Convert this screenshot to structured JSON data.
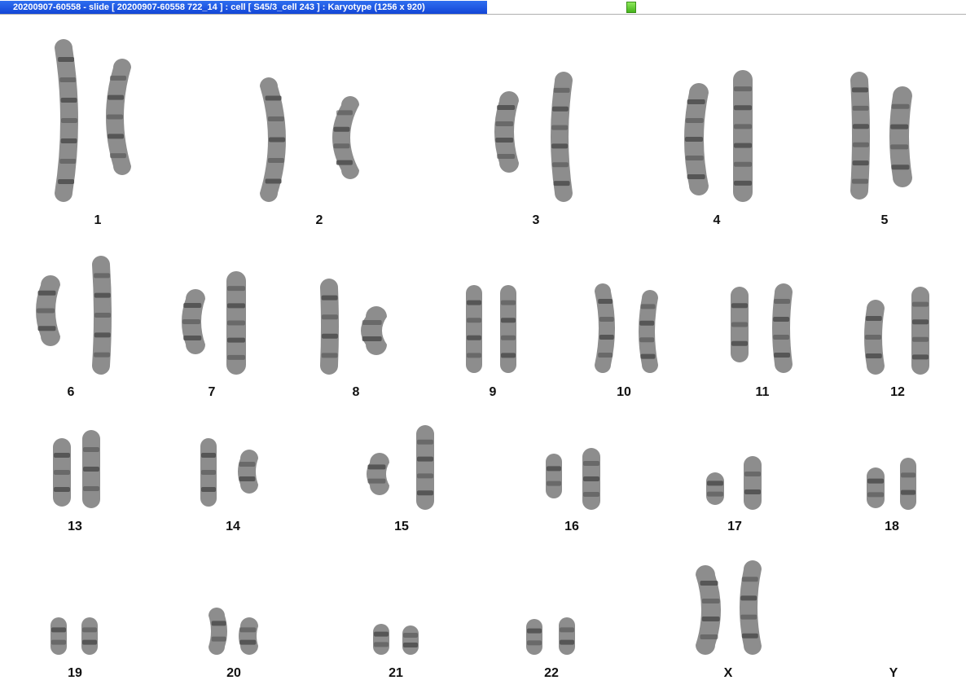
{
  "window": {
    "title": "20200907-60558 - slide [ 20200907-60558 722_14 ] : cell [ S45/3_cell 243 ] : Karyotype  (1256 x 920)"
  },
  "colors": {
    "title_bar": "#1a4fe0",
    "status_indicator": "#6bd43a",
    "chromosome": "#8d8d8d",
    "band": "#4c4c4c"
  },
  "karyotype": {
    "groups": [
      {
        "label": "1",
        "count": 2
      },
      {
        "label": "2",
        "count": 2
      },
      {
        "label": "3",
        "count": 2
      },
      {
        "label": "4",
        "count": 2
      },
      {
        "label": "5",
        "count": 2
      },
      {
        "label": "6",
        "count": 2
      },
      {
        "label": "7",
        "count": 2
      },
      {
        "label": "8",
        "count": 2
      },
      {
        "label": "9",
        "count": 2
      },
      {
        "label": "10",
        "count": 2
      },
      {
        "label": "11",
        "count": 2
      },
      {
        "label": "12",
        "count": 2
      },
      {
        "label": "13",
        "count": 2
      },
      {
        "label": "14",
        "count": 2
      },
      {
        "label": "15",
        "count": 2
      },
      {
        "label": "16",
        "count": 2
      },
      {
        "label": "17",
        "count": 2
      },
      {
        "label": "18",
        "count": 2
      },
      {
        "label": "19",
        "count": 2
      },
      {
        "label": "20",
        "count": 2
      },
      {
        "label": "21",
        "count": 2
      },
      {
        "label": "22",
        "count": 2
      },
      {
        "label": "X",
        "count": 2
      },
      {
        "label": "Y",
        "count": 0
      }
    ]
  }
}
